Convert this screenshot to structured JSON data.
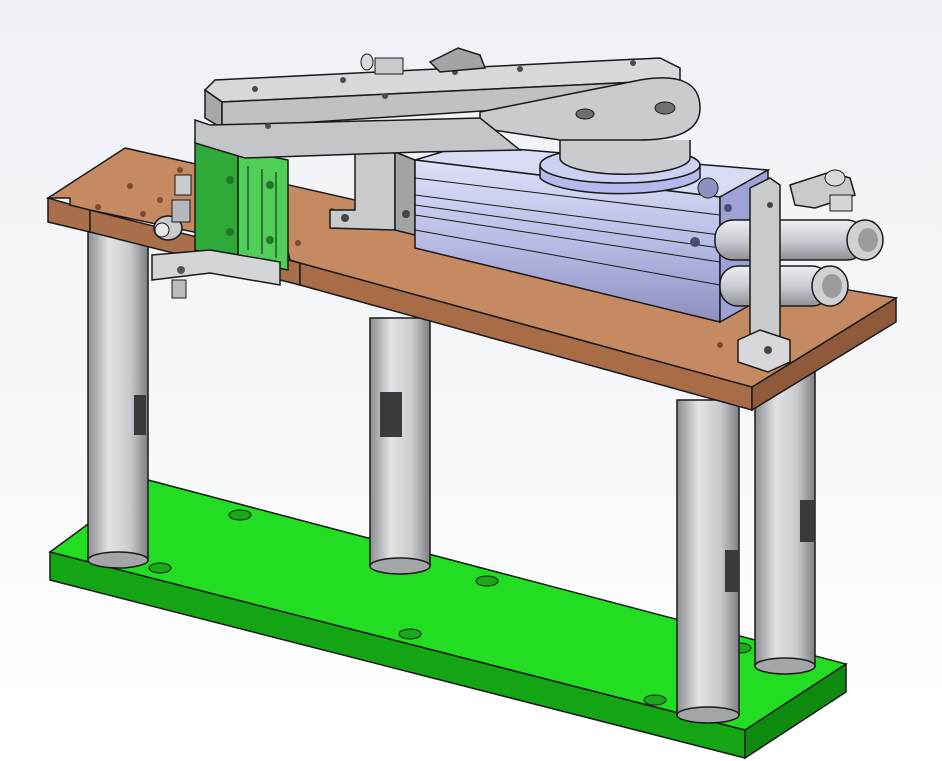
{
  "viewport": {
    "background_top": "#f7f8fb",
    "background_bottom": "#ffffff"
  },
  "colors": {
    "base_plate": "#22dd22",
    "base_plate_side": "#14a514",
    "mounting_plate": "#c58a62",
    "mounting_plate_side": "#8f5a3a",
    "post": "#c9cbcf",
    "metal": "#c8cacc",
    "cylinder_body": "#c5c8ef",
    "guide_cylinder": "#3fbf48",
    "edge": "#1a1a1a"
  },
  "model": {
    "parts": [
      {
        "name": "base-plate",
        "icon": "plate-icon"
      },
      {
        "name": "mounting-plate",
        "icon": "plate-icon"
      },
      {
        "name": "support-post",
        "icon": "column-icon",
        "count": 4
      },
      {
        "name": "rotary-actuator",
        "icon": "cylinder-icon"
      },
      {
        "name": "swing-arm",
        "icon": "arm-icon"
      },
      {
        "name": "guide-cylinder",
        "icon": "cylinder-icon"
      },
      {
        "name": "pneumatic-fittings",
        "icon": "fitting-icon"
      }
    ]
  }
}
